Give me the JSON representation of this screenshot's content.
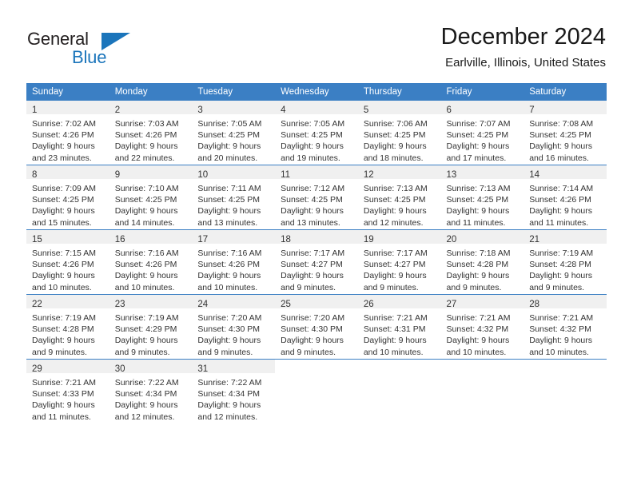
{
  "logo": {
    "word_top": "General",
    "word_bottom": "Blue",
    "accent_color": "#1b75bb",
    "triangle_icon": "triangle-icon"
  },
  "header": {
    "title": "December 2024",
    "subtitle": "Earlville, Illinois, United States"
  },
  "colors": {
    "header_row_bg": "#3b7fc4",
    "header_row_text": "#ffffff",
    "daynum_band_bg": "#f0f0f0",
    "row_separator": "#3b7fc4",
    "body_text": "#333333"
  },
  "weekday_headers": [
    "Sunday",
    "Monday",
    "Tuesday",
    "Wednesday",
    "Thursday",
    "Friday",
    "Saturday"
  ],
  "weeks": [
    [
      {
        "day": "1",
        "sunrise": "Sunrise: 7:02 AM",
        "sunset": "Sunset: 4:26 PM",
        "daylight_1": "Daylight: 9 hours",
        "daylight_2": "and 23 minutes."
      },
      {
        "day": "2",
        "sunrise": "Sunrise: 7:03 AM",
        "sunset": "Sunset: 4:26 PM",
        "daylight_1": "Daylight: 9 hours",
        "daylight_2": "and 22 minutes."
      },
      {
        "day": "3",
        "sunrise": "Sunrise: 7:05 AM",
        "sunset": "Sunset: 4:25 PM",
        "daylight_1": "Daylight: 9 hours",
        "daylight_2": "and 20 minutes."
      },
      {
        "day": "4",
        "sunrise": "Sunrise: 7:05 AM",
        "sunset": "Sunset: 4:25 PM",
        "daylight_1": "Daylight: 9 hours",
        "daylight_2": "and 19 minutes."
      },
      {
        "day": "5",
        "sunrise": "Sunrise: 7:06 AM",
        "sunset": "Sunset: 4:25 PM",
        "daylight_1": "Daylight: 9 hours",
        "daylight_2": "and 18 minutes."
      },
      {
        "day": "6",
        "sunrise": "Sunrise: 7:07 AM",
        "sunset": "Sunset: 4:25 PM",
        "daylight_1": "Daylight: 9 hours",
        "daylight_2": "and 17 minutes."
      },
      {
        "day": "7",
        "sunrise": "Sunrise: 7:08 AM",
        "sunset": "Sunset: 4:25 PM",
        "daylight_1": "Daylight: 9 hours",
        "daylight_2": "and 16 minutes."
      }
    ],
    [
      {
        "day": "8",
        "sunrise": "Sunrise: 7:09 AM",
        "sunset": "Sunset: 4:25 PM",
        "daylight_1": "Daylight: 9 hours",
        "daylight_2": "and 15 minutes."
      },
      {
        "day": "9",
        "sunrise": "Sunrise: 7:10 AM",
        "sunset": "Sunset: 4:25 PM",
        "daylight_1": "Daylight: 9 hours",
        "daylight_2": "and 14 minutes."
      },
      {
        "day": "10",
        "sunrise": "Sunrise: 7:11 AM",
        "sunset": "Sunset: 4:25 PM",
        "daylight_1": "Daylight: 9 hours",
        "daylight_2": "and 13 minutes."
      },
      {
        "day": "11",
        "sunrise": "Sunrise: 7:12 AM",
        "sunset": "Sunset: 4:25 PM",
        "daylight_1": "Daylight: 9 hours",
        "daylight_2": "and 13 minutes."
      },
      {
        "day": "12",
        "sunrise": "Sunrise: 7:13 AM",
        "sunset": "Sunset: 4:25 PM",
        "daylight_1": "Daylight: 9 hours",
        "daylight_2": "and 12 minutes."
      },
      {
        "day": "13",
        "sunrise": "Sunrise: 7:13 AM",
        "sunset": "Sunset: 4:25 PM",
        "daylight_1": "Daylight: 9 hours",
        "daylight_2": "and 11 minutes."
      },
      {
        "day": "14",
        "sunrise": "Sunrise: 7:14 AM",
        "sunset": "Sunset: 4:26 PM",
        "daylight_1": "Daylight: 9 hours",
        "daylight_2": "and 11 minutes."
      }
    ],
    [
      {
        "day": "15",
        "sunrise": "Sunrise: 7:15 AM",
        "sunset": "Sunset: 4:26 PM",
        "daylight_1": "Daylight: 9 hours",
        "daylight_2": "and 10 minutes."
      },
      {
        "day": "16",
        "sunrise": "Sunrise: 7:16 AM",
        "sunset": "Sunset: 4:26 PM",
        "daylight_1": "Daylight: 9 hours",
        "daylight_2": "and 10 minutes."
      },
      {
        "day": "17",
        "sunrise": "Sunrise: 7:16 AM",
        "sunset": "Sunset: 4:26 PM",
        "daylight_1": "Daylight: 9 hours",
        "daylight_2": "and 10 minutes."
      },
      {
        "day": "18",
        "sunrise": "Sunrise: 7:17 AM",
        "sunset": "Sunset: 4:27 PM",
        "daylight_1": "Daylight: 9 hours",
        "daylight_2": "and 9 minutes."
      },
      {
        "day": "19",
        "sunrise": "Sunrise: 7:17 AM",
        "sunset": "Sunset: 4:27 PM",
        "daylight_1": "Daylight: 9 hours",
        "daylight_2": "and 9 minutes."
      },
      {
        "day": "20",
        "sunrise": "Sunrise: 7:18 AM",
        "sunset": "Sunset: 4:28 PM",
        "daylight_1": "Daylight: 9 hours",
        "daylight_2": "and 9 minutes."
      },
      {
        "day": "21",
        "sunrise": "Sunrise: 7:19 AM",
        "sunset": "Sunset: 4:28 PM",
        "daylight_1": "Daylight: 9 hours",
        "daylight_2": "and 9 minutes."
      }
    ],
    [
      {
        "day": "22",
        "sunrise": "Sunrise: 7:19 AM",
        "sunset": "Sunset: 4:28 PM",
        "daylight_1": "Daylight: 9 hours",
        "daylight_2": "and 9 minutes."
      },
      {
        "day": "23",
        "sunrise": "Sunrise: 7:19 AM",
        "sunset": "Sunset: 4:29 PM",
        "daylight_1": "Daylight: 9 hours",
        "daylight_2": "and 9 minutes."
      },
      {
        "day": "24",
        "sunrise": "Sunrise: 7:20 AM",
        "sunset": "Sunset: 4:30 PM",
        "daylight_1": "Daylight: 9 hours",
        "daylight_2": "and 9 minutes."
      },
      {
        "day": "25",
        "sunrise": "Sunrise: 7:20 AM",
        "sunset": "Sunset: 4:30 PM",
        "daylight_1": "Daylight: 9 hours",
        "daylight_2": "and 9 minutes."
      },
      {
        "day": "26",
        "sunrise": "Sunrise: 7:21 AM",
        "sunset": "Sunset: 4:31 PM",
        "daylight_1": "Daylight: 9 hours",
        "daylight_2": "and 10 minutes."
      },
      {
        "day": "27",
        "sunrise": "Sunrise: 7:21 AM",
        "sunset": "Sunset: 4:32 PM",
        "daylight_1": "Daylight: 9 hours",
        "daylight_2": "and 10 minutes."
      },
      {
        "day": "28",
        "sunrise": "Sunrise: 7:21 AM",
        "sunset": "Sunset: 4:32 PM",
        "daylight_1": "Daylight: 9 hours",
        "daylight_2": "and 10 minutes."
      }
    ],
    [
      {
        "day": "29",
        "sunrise": "Sunrise: 7:21 AM",
        "sunset": "Sunset: 4:33 PM",
        "daylight_1": "Daylight: 9 hours",
        "daylight_2": "and 11 minutes."
      },
      {
        "day": "30",
        "sunrise": "Sunrise: 7:22 AM",
        "sunset": "Sunset: 4:34 PM",
        "daylight_1": "Daylight: 9 hours",
        "daylight_2": "and 12 minutes."
      },
      {
        "day": "31",
        "sunrise": "Sunrise: 7:22 AM",
        "sunset": "Sunset: 4:34 PM",
        "daylight_1": "Daylight: 9 hours",
        "daylight_2": "and 12 minutes."
      },
      {
        "day": "",
        "sunrise": "",
        "sunset": "",
        "daylight_1": "",
        "daylight_2": ""
      },
      {
        "day": "",
        "sunrise": "",
        "sunset": "",
        "daylight_1": "",
        "daylight_2": ""
      },
      {
        "day": "",
        "sunrise": "",
        "sunset": "",
        "daylight_1": "",
        "daylight_2": ""
      },
      {
        "day": "",
        "sunrise": "",
        "sunset": "",
        "daylight_1": "",
        "daylight_2": ""
      }
    ]
  ]
}
